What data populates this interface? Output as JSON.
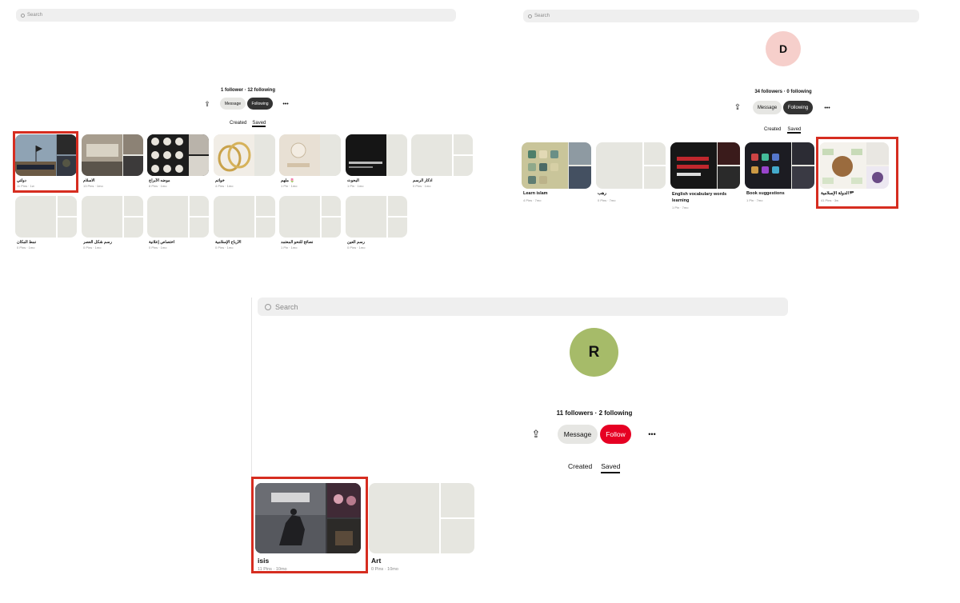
{
  "colors": {
    "highlight": "#d62d20",
    "follow_button": "#e60023",
    "following_button": "#333333",
    "board_placeholder": "#e6e6e0"
  },
  "icons": {
    "search": "search-icon",
    "share": "share-icon",
    "more": "more-icon"
  },
  "panel1": {
    "search_placeholder": "Search",
    "stats": "1 follower · 12 following",
    "share_icon": "⇪",
    "message_label": "Message",
    "following_label": "Following",
    "more_icon": "•••",
    "tab_created": "Created",
    "tab_saved": "Saved",
    "boards": [
      {
        "title": "دولتي",
        "meta": "11 Pins · 1w"
      },
      {
        "title": "الاسلام",
        "meta": "13 Pins · 1mo"
      },
      {
        "title": "موضه الأبراج",
        "meta": "8 Pins · 1mo"
      },
      {
        "title": "خواتم",
        "meta": "4 Pins · 1mo"
      },
      {
        "title": "ملهم 🌷",
        "meta": "1 Pin · 1mo"
      },
      {
        "title": "البحوث",
        "meta": "1 Pin · 1mo"
      },
      {
        "title": "اذكار الرسم",
        "meta": "0 Pins · 1mo"
      },
      {
        "title": "نمط المكان",
        "meta": "0 Pins · 1mo"
      },
      {
        "title": "رسم شكل العصر",
        "meta": "0 Pins · 1mo"
      },
      {
        "title": "اختصاص إعلانية",
        "meta": "0 Pins · 1mo"
      },
      {
        "title": "الأرباح الإسلامية",
        "meta": "0 Pins · 1mo"
      },
      {
        "title": "نصائح للنحو المعتمد",
        "meta": "1 Pin · 1mo"
      },
      {
        "title": "رسم العين",
        "meta": "0 Pins · 1mo"
      }
    ]
  },
  "panel2": {
    "search_placeholder": "Search",
    "avatar_letter": "D",
    "stats": "34 followers · 0 following",
    "share_icon": "⇪",
    "message_label": "Message",
    "following_label": "Following",
    "more_icon": "•••",
    "tab_created": "Created",
    "tab_saved": "Saved",
    "boards": [
      {
        "title": "Learn islam",
        "meta": "4 Pins · 7mo"
      },
      {
        "title": "رهب",
        "meta": "0 Pins · 7mo"
      },
      {
        "title": "English vocabulary words learning",
        "meta": "1 Pin · 7mo"
      },
      {
        "title": "Book suggestions",
        "meta": "1 Pin · 7mo"
      },
      {
        "title": "الدولة الإسلامية🏴",
        "meta": "41 Pins · 3w"
      }
    ]
  },
  "panel3": {
    "search_placeholder": "Search",
    "avatar_letter": "R",
    "stats": "11 followers · 2 following",
    "share_icon": "⇪",
    "message_label": "Message",
    "follow_label": "Follow",
    "more_icon": "•••",
    "tab_created": "Created",
    "tab_saved": "Saved",
    "boards": [
      {
        "title": "isis",
        "meta": "11 Pins · 10mo"
      },
      {
        "title": "Art",
        "meta": "0 Pins · 10mo"
      }
    ]
  }
}
